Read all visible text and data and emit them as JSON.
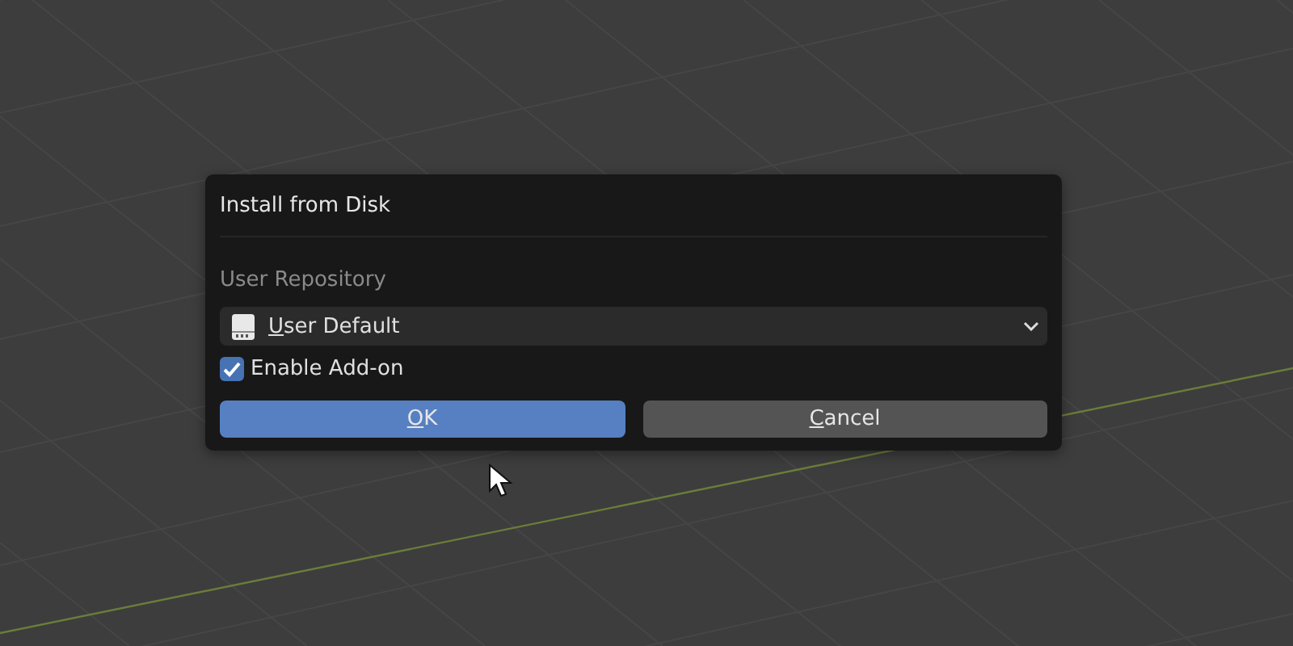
{
  "dialog": {
    "title": "Install from Disk",
    "repository": {
      "label": "User Repository",
      "value": "User Default"
    },
    "enable_addon": {
      "label": "Enable Add-on",
      "checked": true
    },
    "buttons": [
      {
        "label": "OK",
        "kind": "primary"
      },
      {
        "label": "Cancel",
        "kind": "secondary"
      }
    ]
  }
}
